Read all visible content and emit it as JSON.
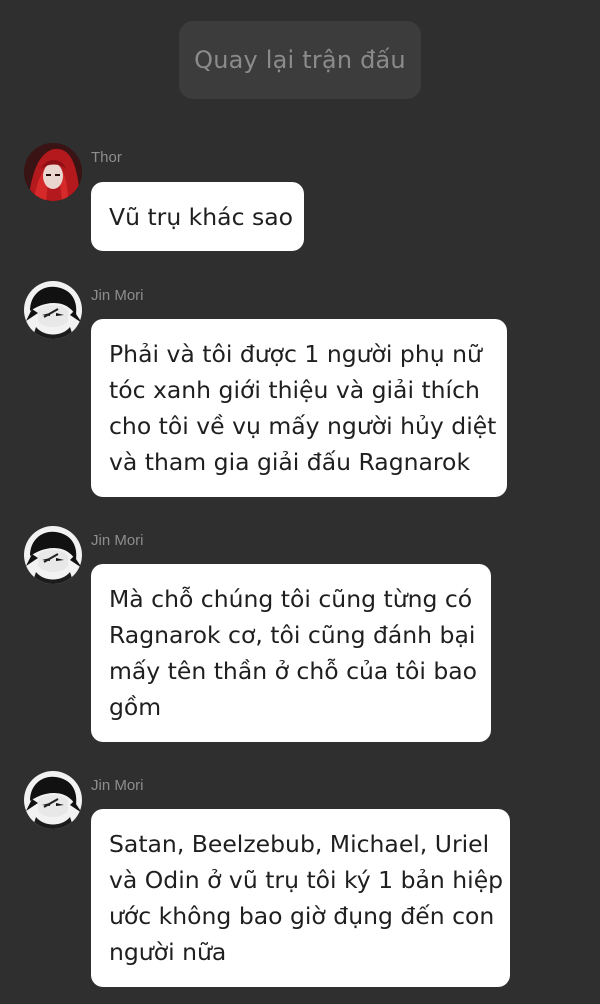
{
  "top_button": {
    "label": "Quay lại trận đấu"
  },
  "messages": [
    {
      "sender": "Thor",
      "avatar_icon": "thor-avatar",
      "lines": [
        "Vũ trụ khác sao"
      ]
    },
    {
      "sender": "Jin Mori",
      "avatar_icon": "jin-mori-avatar",
      "lines": [
        "Phải và tôi được 1 người phụ nữ",
        "tóc xanh giới thiệu và giải thích",
        "cho tôi về vụ mấy người hủy diệt",
        "và tham gia giải đấu Ragnarok"
      ]
    },
    {
      "sender": "Jin Mori",
      "avatar_icon": "jin-mori-avatar",
      "lines": [
        "Mà chỗ chúng tôi cũng từng có",
        "Ragnarok cơ, tôi cũng đánh bại",
        "mấy tên thần ở chỗ của tôi bao",
        "gồm"
      ]
    },
    {
      "sender": "Jin Mori",
      "avatar_icon": "jin-mori-avatar",
      "lines": [
        "Satan, Beelzebub, Michael, Uriel",
        "và Odin ở vũ trụ tôi ký 1 bản hiệp",
        "ước không bao giờ đụng đến con",
        "người nữa"
      ]
    }
  ],
  "colors": {
    "background": "#2f2f2f",
    "bubble": "#ffffff",
    "top_button_bg": "#3c3c3c",
    "name_text": "#8d8d8d"
  }
}
